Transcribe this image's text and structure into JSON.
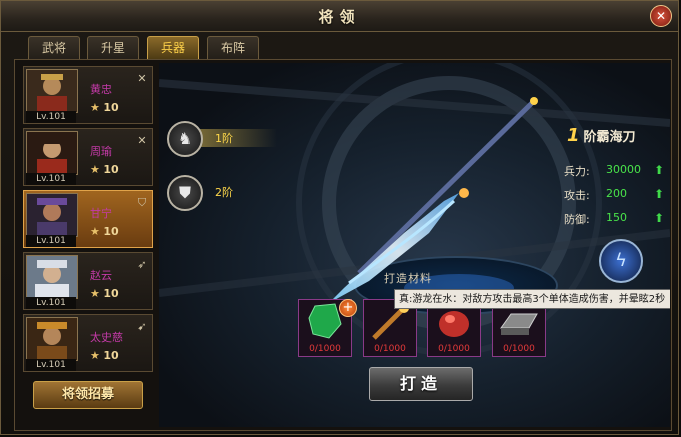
{
  "window": {
    "title": "将领",
    "close_label": "✕"
  },
  "tabs": [
    {
      "label": "武将"
    },
    {
      "label": "升星"
    },
    {
      "label": "兵器",
      "active": true
    },
    {
      "label": "布阵"
    }
  ],
  "generals": [
    {
      "name": "黄忠",
      "level": "Lv.101",
      "stars": "10",
      "weapon_icon": "crossbow-icon",
      "selected": false
    },
    {
      "name": "周瑜",
      "level": "Lv.101",
      "stars": "10",
      "weapon_icon": "crossbow-icon",
      "selected": false
    },
    {
      "name": "甘宁",
      "level": "Lv.101",
      "stars": "10",
      "weapon_icon": "shield-icon",
      "selected": true
    },
    {
      "name": "赵云",
      "level": "Lv.101",
      "stars": "10",
      "weapon_icon": "spear-icon",
      "selected": false
    },
    {
      "name": "太史慈",
      "level": "Lv.101",
      "stars": "10",
      "weapon_icon": "sword-icon",
      "selected": false
    }
  ],
  "recruit_label": "将领招募",
  "tiers": [
    {
      "label": "1阶",
      "icon": "hourse-rider-icon",
      "active": true
    },
    {
      "label": "2阶",
      "icon": "shield-icon",
      "active": false
    }
  ],
  "weapon": {
    "tier_num": "1",
    "name": "阶霸海刀",
    "stats": [
      {
        "label": "兵力:",
        "value": "30000"
      },
      {
        "label": "攻击:",
        "value": "200"
      },
      {
        "label": "防御:",
        "value": "150"
      }
    ]
  },
  "materials_title": "打造材料",
  "tooltip": "真:游龙在水：对敌方攻击最高3个单体造成伤害，并晕眩2秒",
  "materials": [
    {
      "name": "jade",
      "count": "0/1000",
      "color": "#1fa84a"
    },
    {
      "name": "staff",
      "count": "0/1000",
      "color": "#c07a2a"
    },
    {
      "name": "red-ore",
      "count": "0/1000",
      "color": "#c0302a"
    },
    {
      "name": "iron",
      "count": "0/1000",
      "color": "#8a8a8a"
    }
  ],
  "forge_label": "打造",
  "colors": {
    "accent_gold": "#ffd24a",
    "stat_green": "#49e34a",
    "name_purple": "#c43aa8",
    "count_red": "#e43a3a"
  }
}
